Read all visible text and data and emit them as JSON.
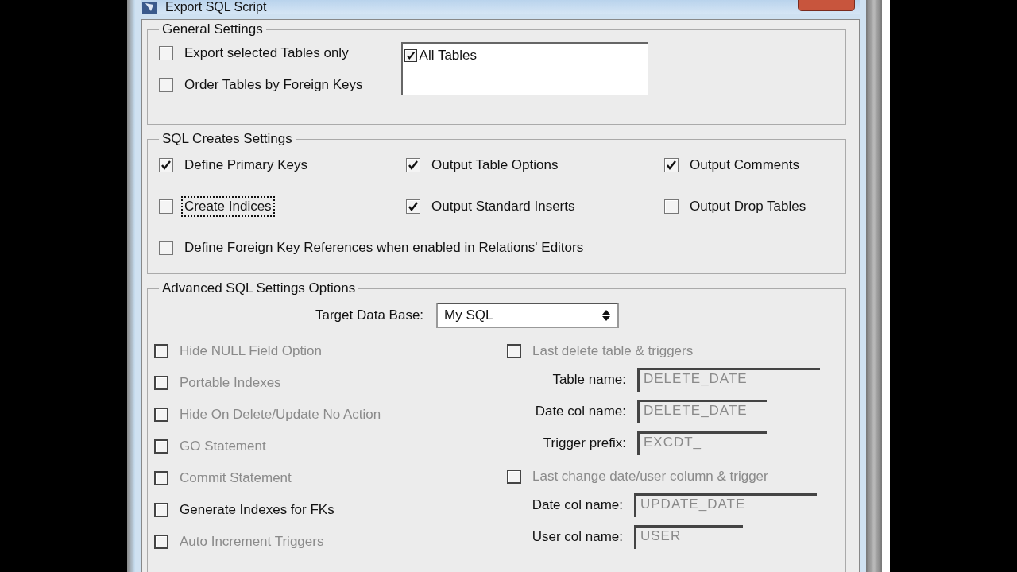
{
  "window": {
    "title": "Export SQL Script"
  },
  "general_settings": {
    "title": "General Settings",
    "options": [
      {
        "label": "Export selected Tables only",
        "checked": false
      },
      {
        "label": "Order Tables by Foreign Keys",
        "checked": false
      }
    ],
    "tables_list": [
      {
        "label": "All Tables",
        "checked": true
      }
    ]
  },
  "sql_creates_settings": {
    "title": "SQL Creates Settings",
    "options": [
      {
        "label": "Define Primary Keys",
        "checked": true,
        "focused": false
      },
      {
        "label": "Output Table Options",
        "checked": true,
        "focused": false
      },
      {
        "label": "Output Comments",
        "checked": true,
        "focused": false
      },
      {
        "label": "Create Indices",
        "checked": false,
        "focused": true
      },
      {
        "label": "Output Standard Inserts",
        "checked": true,
        "focused": false
      },
      {
        "label": "Output Drop Tables",
        "checked": false,
        "focused": false
      },
      {
        "label": "Define Foreign Key References when enabled in Relations' Editors",
        "checked": false,
        "focused": false
      }
    ]
  },
  "advanced_sql_settings": {
    "title": "Advanced SQL Settings Options",
    "target_label": "Target Data Base:",
    "target_value": "My SQL",
    "options": [
      {
        "label": "Hide NULL Field Option",
        "checked": false,
        "disabled": true
      },
      {
        "label": "Portable Indexes",
        "checked": false,
        "disabled": true
      },
      {
        "label": "Hide On Delete/Update No Action",
        "checked": false,
        "disabled": true
      },
      {
        "label": "GO Statement",
        "checked": false,
        "disabled": true
      },
      {
        "label": "Commit Statement",
        "checked": false,
        "disabled": true
      },
      {
        "label": "Generate Indexes for FKs",
        "checked": false,
        "disabled": false
      },
      {
        "label": "Auto Increment Triggers",
        "checked": false,
        "disabled": true
      }
    ],
    "groups": [
      {
        "label": "Last delete table & triggers",
        "checked": false,
        "disabled": true,
        "fields": [
          {
            "label": "Table name:",
            "value": "DELETE_DATE"
          },
          {
            "label": "Date col name:",
            "value": "DELETE_DATE"
          },
          {
            "label": "Trigger prefix:",
            "value": "EXCDT_"
          }
        ]
      },
      {
        "label": "Last change date/user column & trigger",
        "checked": false,
        "disabled": true,
        "fields": [
          {
            "label": "Date col name:",
            "value": "UPDATE_DATE"
          },
          {
            "label": "User col name:",
            "value": "USER"
          }
        ]
      }
    ]
  }
}
